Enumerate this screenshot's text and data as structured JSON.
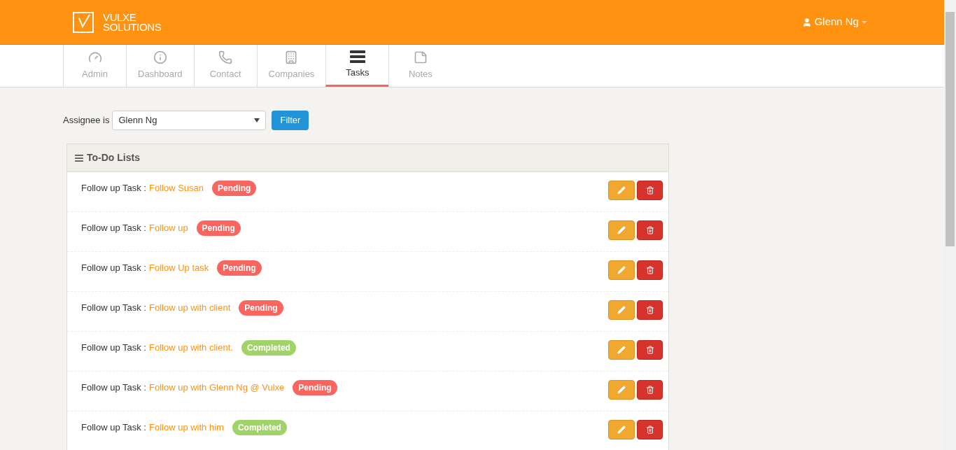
{
  "header": {
    "logo_line_1": "VULXE",
    "logo_line_2": "SOLUTIONS",
    "user": "Glenn Ng"
  },
  "tabs": [
    {
      "label": "Admin",
      "kind": "gauge",
      "selected": false
    },
    {
      "label": "Dashboard",
      "kind": "info",
      "selected": false
    },
    {
      "label": "Contact",
      "kind": "phone",
      "selected": false
    },
    {
      "label": "Companies",
      "kind": "building",
      "selected": false
    },
    {
      "label": "Tasks",
      "kind": "tasks",
      "selected": true
    },
    {
      "label": "Notes",
      "kind": "note",
      "selected": false
    }
  ],
  "filter": {
    "label": "Assignee is",
    "value": "Glenn Ng",
    "button": "Filter"
  },
  "panel": {
    "title": "To-Do Lists"
  },
  "tasks": [
    {
      "prefix": "Follow up Task :",
      "title": "Follow Susan",
      "status": "Pending",
      "color": "#f8665f"
    },
    {
      "prefix": "Follow up Task :",
      "title": "Follow up",
      "status": "Pending",
      "color": "#f8665f"
    },
    {
      "prefix": "Follow up Task :",
      "title": "Follow Up task",
      "status": "Pending",
      "color": "#f8665f"
    },
    {
      "prefix": "Follow up Task :",
      "title": "Follow up with client",
      "status": "Pending",
      "color": "#f8665f"
    },
    {
      "prefix": "Follow up Task :",
      "title": "Follow up with client.",
      "status": "Completed",
      "color": "#a0d468"
    },
    {
      "prefix": "Follow up Task :",
      "title": "Follow up with Glenn Ng @ Vulxe",
      "status": "Pending",
      "color": "#f8665f"
    },
    {
      "prefix": "Follow up Task :",
      "title": "Follow up with him",
      "status": "Completed",
      "color": "#a0d468"
    }
  ]
}
